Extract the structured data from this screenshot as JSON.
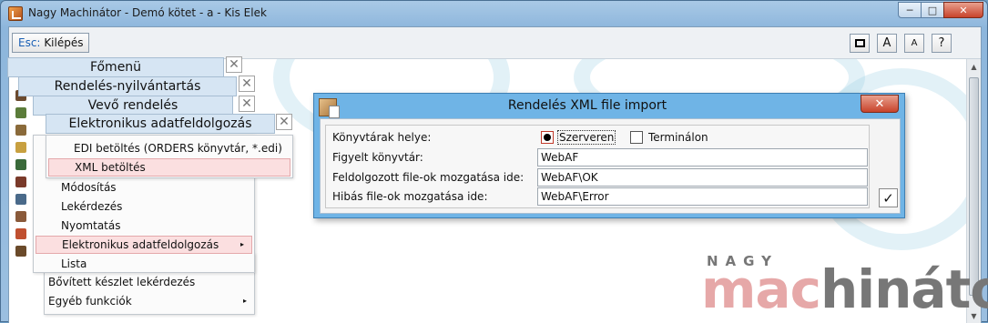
{
  "window": {
    "title": "Nagy Machinátor - Demó kötet - a - Kis Elek",
    "controls": {
      "minimize": "─",
      "maximize": "□",
      "close": "✕"
    }
  },
  "toolbar": {
    "exit_key": "Esc:",
    "exit_label": "Kilépés",
    "right_buttons": [
      "□",
      "A",
      "A",
      "?"
    ]
  },
  "menus": {
    "main": {
      "title": "Főmenü"
    },
    "orders": {
      "title": "Rendelés-nyilvántartás"
    },
    "customer_orders": {
      "title": "Vevő rendelés"
    },
    "edi": {
      "title": "Elektronikus adatfeldolgozás"
    },
    "edi_items": [
      "EDI betöltés (ORDERS könyvtár, *.edi)",
      "XML betöltés"
    ],
    "customer_order_items": [
      "Módosítás",
      "Lekérdezés",
      "Nyomtatás",
      "Elektronikus adatfeldolgozás",
      "Lista"
    ],
    "main_items": [
      "Bővített készlet lekérdezés",
      "Egyéb funkciók"
    ],
    "arrow": "▸",
    "close_glyph": "✕"
  },
  "dialog": {
    "title": "Rendelés XML file import",
    "close": "✕",
    "labels": {
      "library_location": "Könyvtárak helye:",
      "watched_dir": "Figyelt könyvtár:",
      "processed_move": "Feldolgozott file-ok mozgatása ide:",
      "error_move": "Hibás file-ok mozgatása ide:"
    },
    "radio": {
      "server": "Szerveren",
      "terminal": "Terminálon",
      "selected": "server"
    },
    "values": {
      "watched_dir": "WebAF",
      "processed_move": "WebAF\\OK",
      "error_move": "WebAF\\Error"
    },
    "ok": "✓"
  },
  "logo": {
    "top": "NAGY",
    "word_part1": "mac",
    "word_part2": "hinátor"
  },
  "colors": {
    "dialog_titlebar": "#6fb4e6",
    "highlight": "#fbdfe0",
    "panel_head": "#d6e5f3",
    "close_red": "#c8432b"
  }
}
